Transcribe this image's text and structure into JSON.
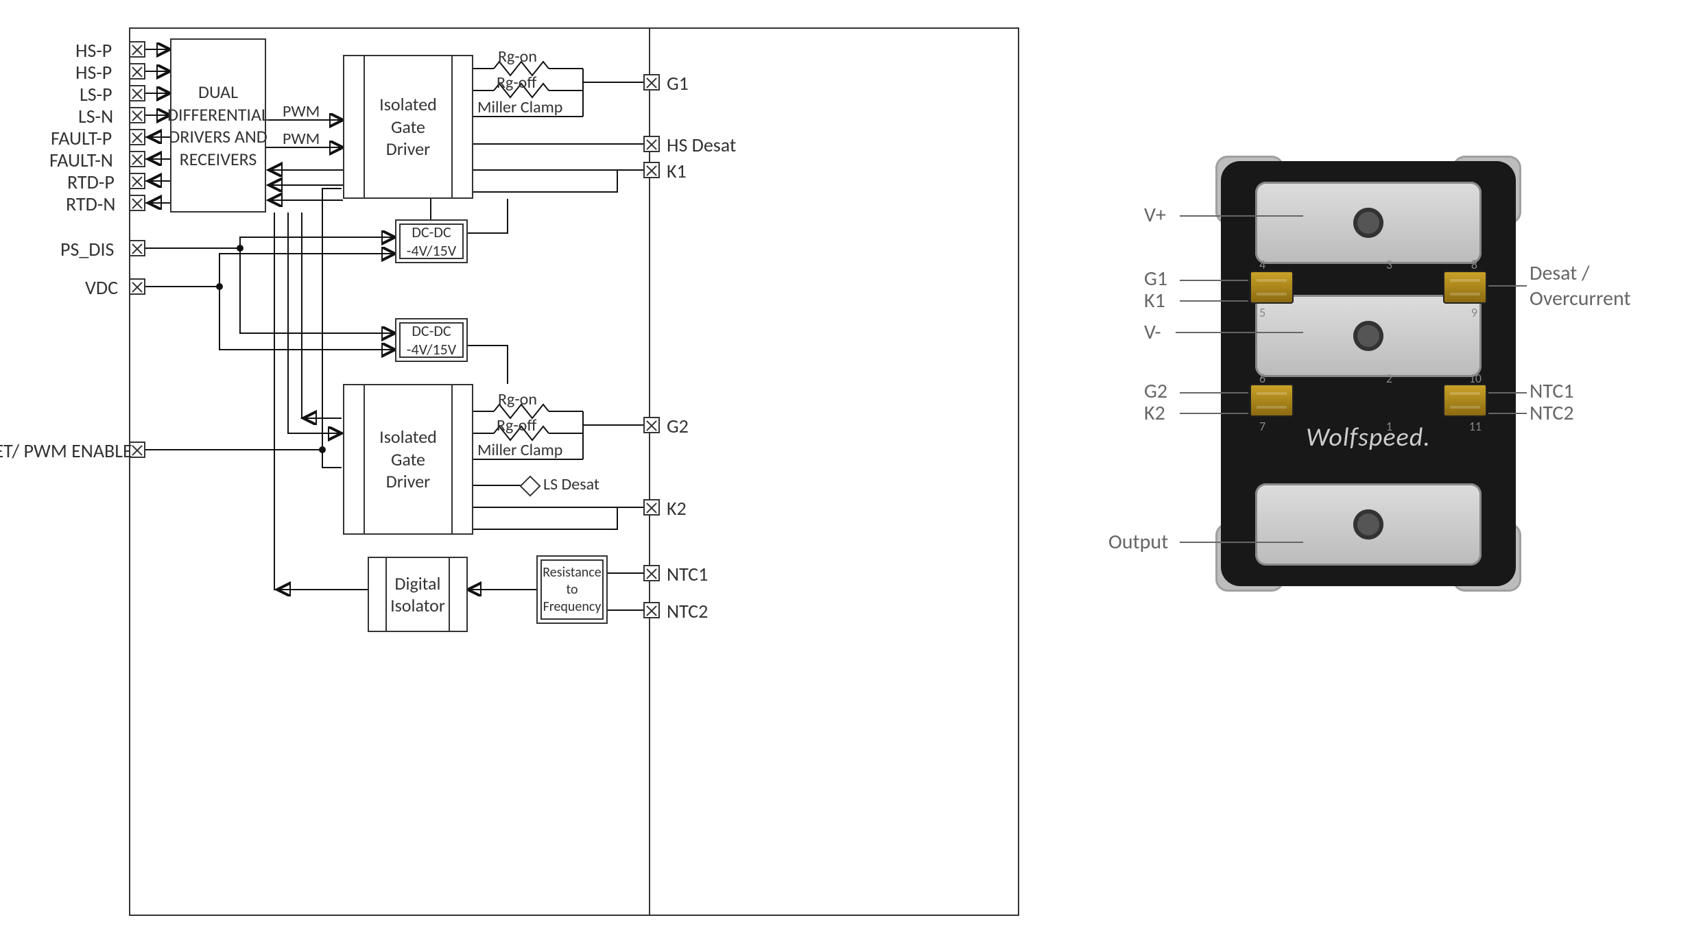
{
  "left_pins": {
    "hs_p1": "HS-P",
    "hs_p2": "HS-P",
    "ls_p": "LS-P",
    "ls_n": "LS-N",
    "fault_p": "FAULT-P",
    "fault_n": "FAULT-N",
    "rtd_p": "RTD-P",
    "rtd_n": "RTD-N",
    "ps_dis": "PS_DIS",
    "vdc": "VDC",
    "reset": "RESET/ PWM ENABLE"
  },
  "right_pins": {
    "g1": "G1",
    "hs_desat": "HS Desat",
    "k1": "K1",
    "g2": "G2",
    "k2": "K2",
    "ntc1": "NTC1",
    "ntc2": "NTC2"
  },
  "blocks": {
    "diff": "DUAL\nDIFFERENTIAL\nDRIVERS AND\nRECEIVERS",
    "igd": "Isolated\nGate\nDriver",
    "dcdc": "DC-DC\n-4V/15V",
    "digiso": "Digital\nIsolator",
    "r2f": "Resistance\nto\nFrequency"
  },
  "signals": {
    "pwm": "PWM",
    "rg_on": "Rg-on",
    "rg_off": "Rg-off",
    "miller": "Miller Clamp",
    "ls_desat": "LS Desat"
  },
  "module_labels": {
    "vp": "V+",
    "g1": "G1",
    "k1": "K1",
    "vm": "V-",
    "g2": "G2",
    "k2": "K2",
    "out": "Output",
    "desat": "Desat /\nOvercurrent",
    "ntc1": "NTC1",
    "ntc2": "NTC2",
    "brand": "Wolfspeed."
  },
  "module_pin_numbers": [
    "1",
    "2",
    "3",
    "4",
    "5",
    "6",
    "7",
    "8",
    "9",
    "10",
    "11"
  ]
}
